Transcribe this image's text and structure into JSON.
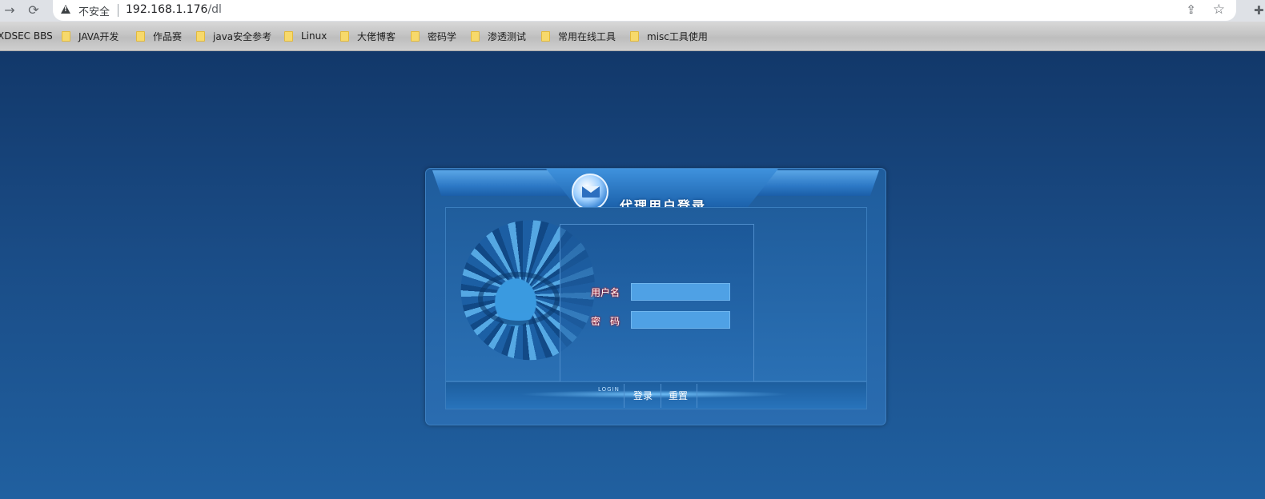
{
  "browser": {
    "nav": {
      "forward_icon": "→",
      "reload_icon": "⟳"
    },
    "security_label": "不安全",
    "url_host": "192.168.1.176",
    "url_path": "/dl",
    "share_icon": "⇪",
    "star_icon": "☆",
    "extension_icon": "✚"
  },
  "bookmarks": [
    {
      "label": "XDSEC BBS"
    },
    {
      "label": "JAVA开发"
    },
    {
      "label": "作品赛"
    },
    {
      "label": "java安全参考"
    },
    {
      "label": "Linux"
    },
    {
      "label": "大佬博客"
    },
    {
      "label": "密码学"
    },
    {
      "label": "渗透测试"
    },
    {
      "label": "常用在线工具"
    },
    {
      "label": "misc工具使用"
    }
  ],
  "login": {
    "title": "代理用户登录",
    "username_label": "用户名",
    "username_value": "",
    "password_label": "密　码",
    "password_value": "",
    "footer_caption": "LOGIN",
    "submit_label": "登录",
    "reset_label": "重置"
  }
}
